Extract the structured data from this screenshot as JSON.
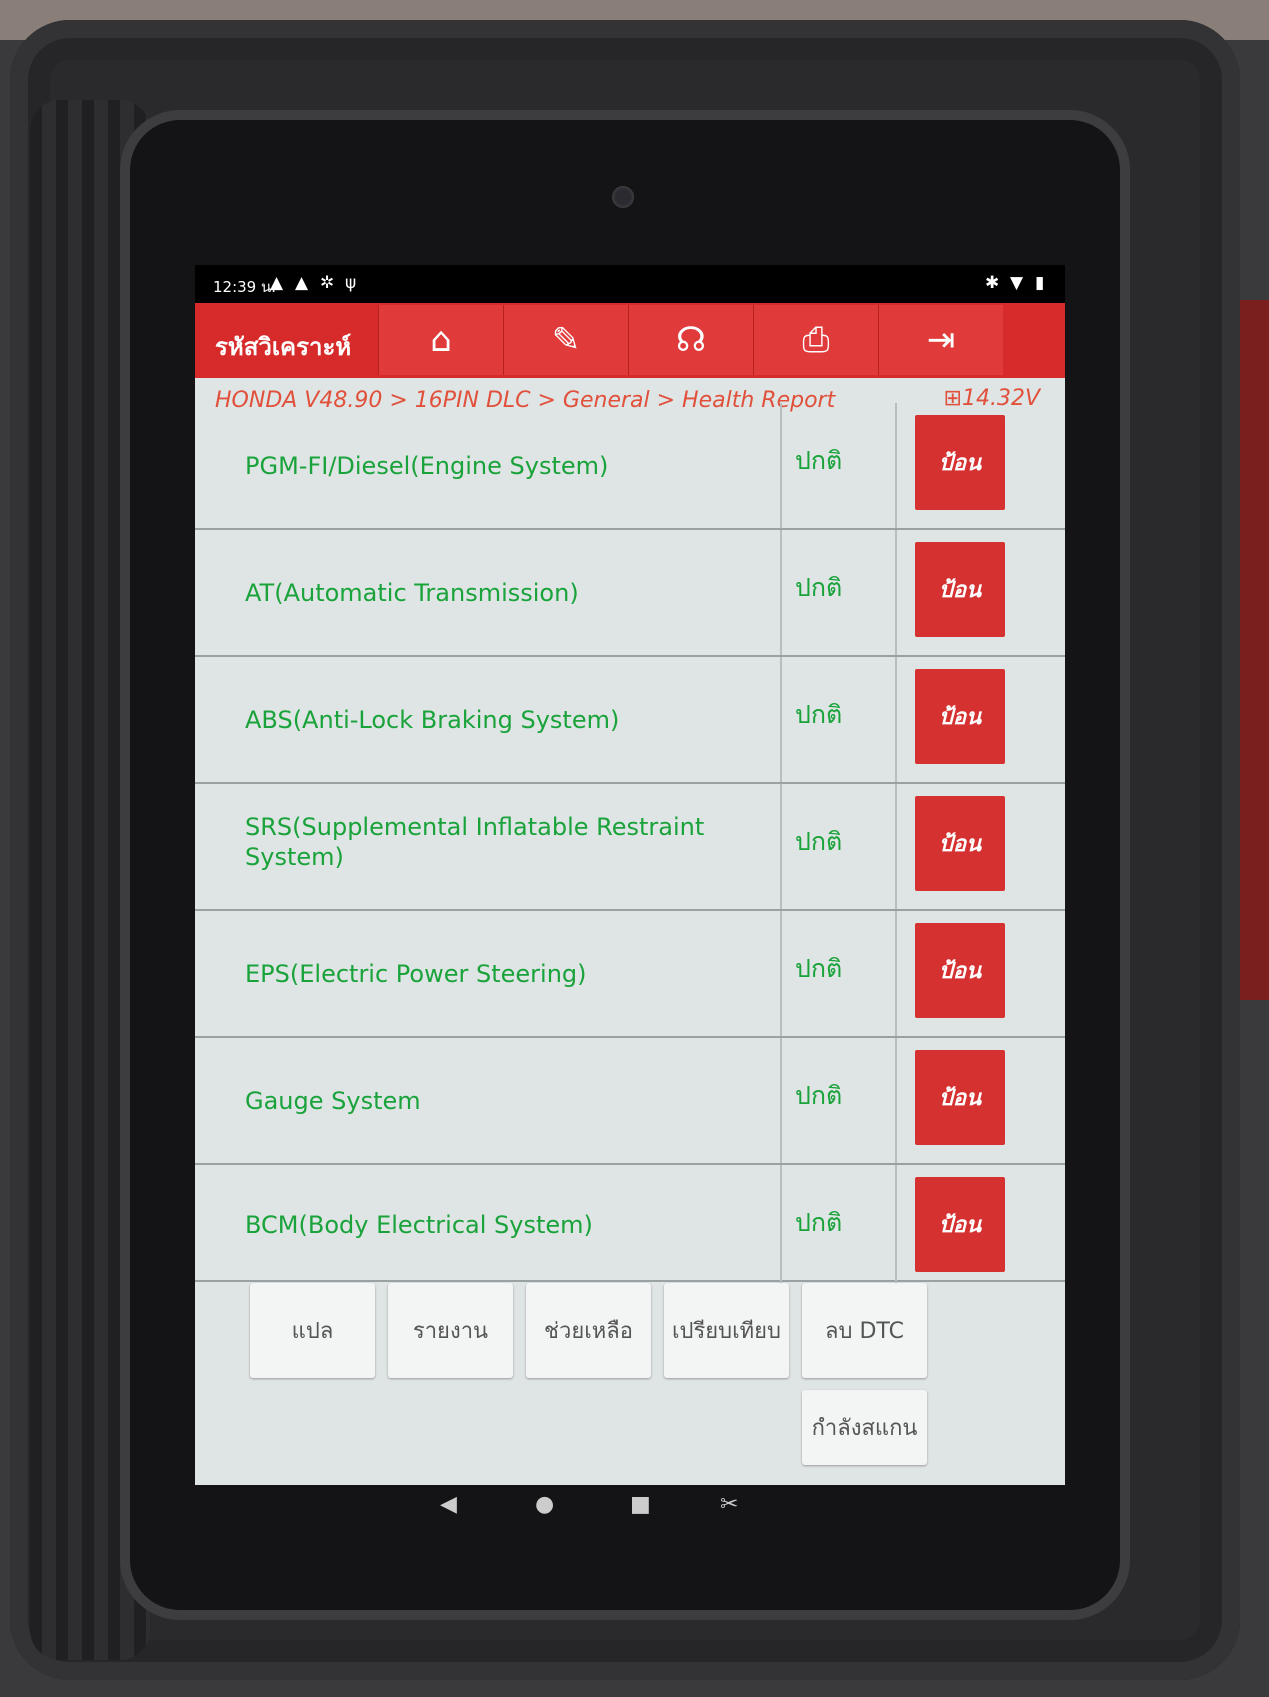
{
  "statusbar": {
    "time": "12:39 น."
  },
  "toolbar": {
    "title": "รหัสวิเคราะห์"
  },
  "breadcrumb": "HONDA V48.90 > 16PIN DLC > General > Health Report",
  "voltage": "14.32V",
  "rows": [
    {
      "name": "PGM-FI/Diesel(Engine System)",
      "status": "ปกติ",
      "action": "ป้อน"
    },
    {
      "name": "AT(Automatic Transmission)",
      "status": "ปกติ",
      "action": "ป้อน"
    },
    {
      "name": "ABS(Anti-Lock Braking System)",
      "status": "ปกติ",
      "action": "ป้อน"
    },
    {
      "name": "SRS(Supplemental Inflatable Restraint System)",
      "status": "ปกติ",
      "action": "ป้อน"
    },
    {
      "name": "EPS(Electric Power Steering)",
      "status": "ปกติ",
      "action": "ป้อน"
    },
    {
      "name": "Gauge System",
      "status": "ปกติ",
      "action": "ป้อน"
    },
    {
      "name": "BCM(Body Electrical System)",
      "status": "ปกติ",
      "action": "ป้อน"
    }
  ],
  "footer": {
    "translate": "แปล",
    "report": "รายงาน",
    "help": "ช่วยเหลือ",
    "compare": "เปรียบเทียบ",
    "clear_dtc": "ลบ DTC",
    "scanning": "กำลังสแกน"
  },
  "colors": {
    "accent": "#d72b2b",
    "status_ok": "#19a33a",
    "breadcrumb": "#e0503a"
  }
}
